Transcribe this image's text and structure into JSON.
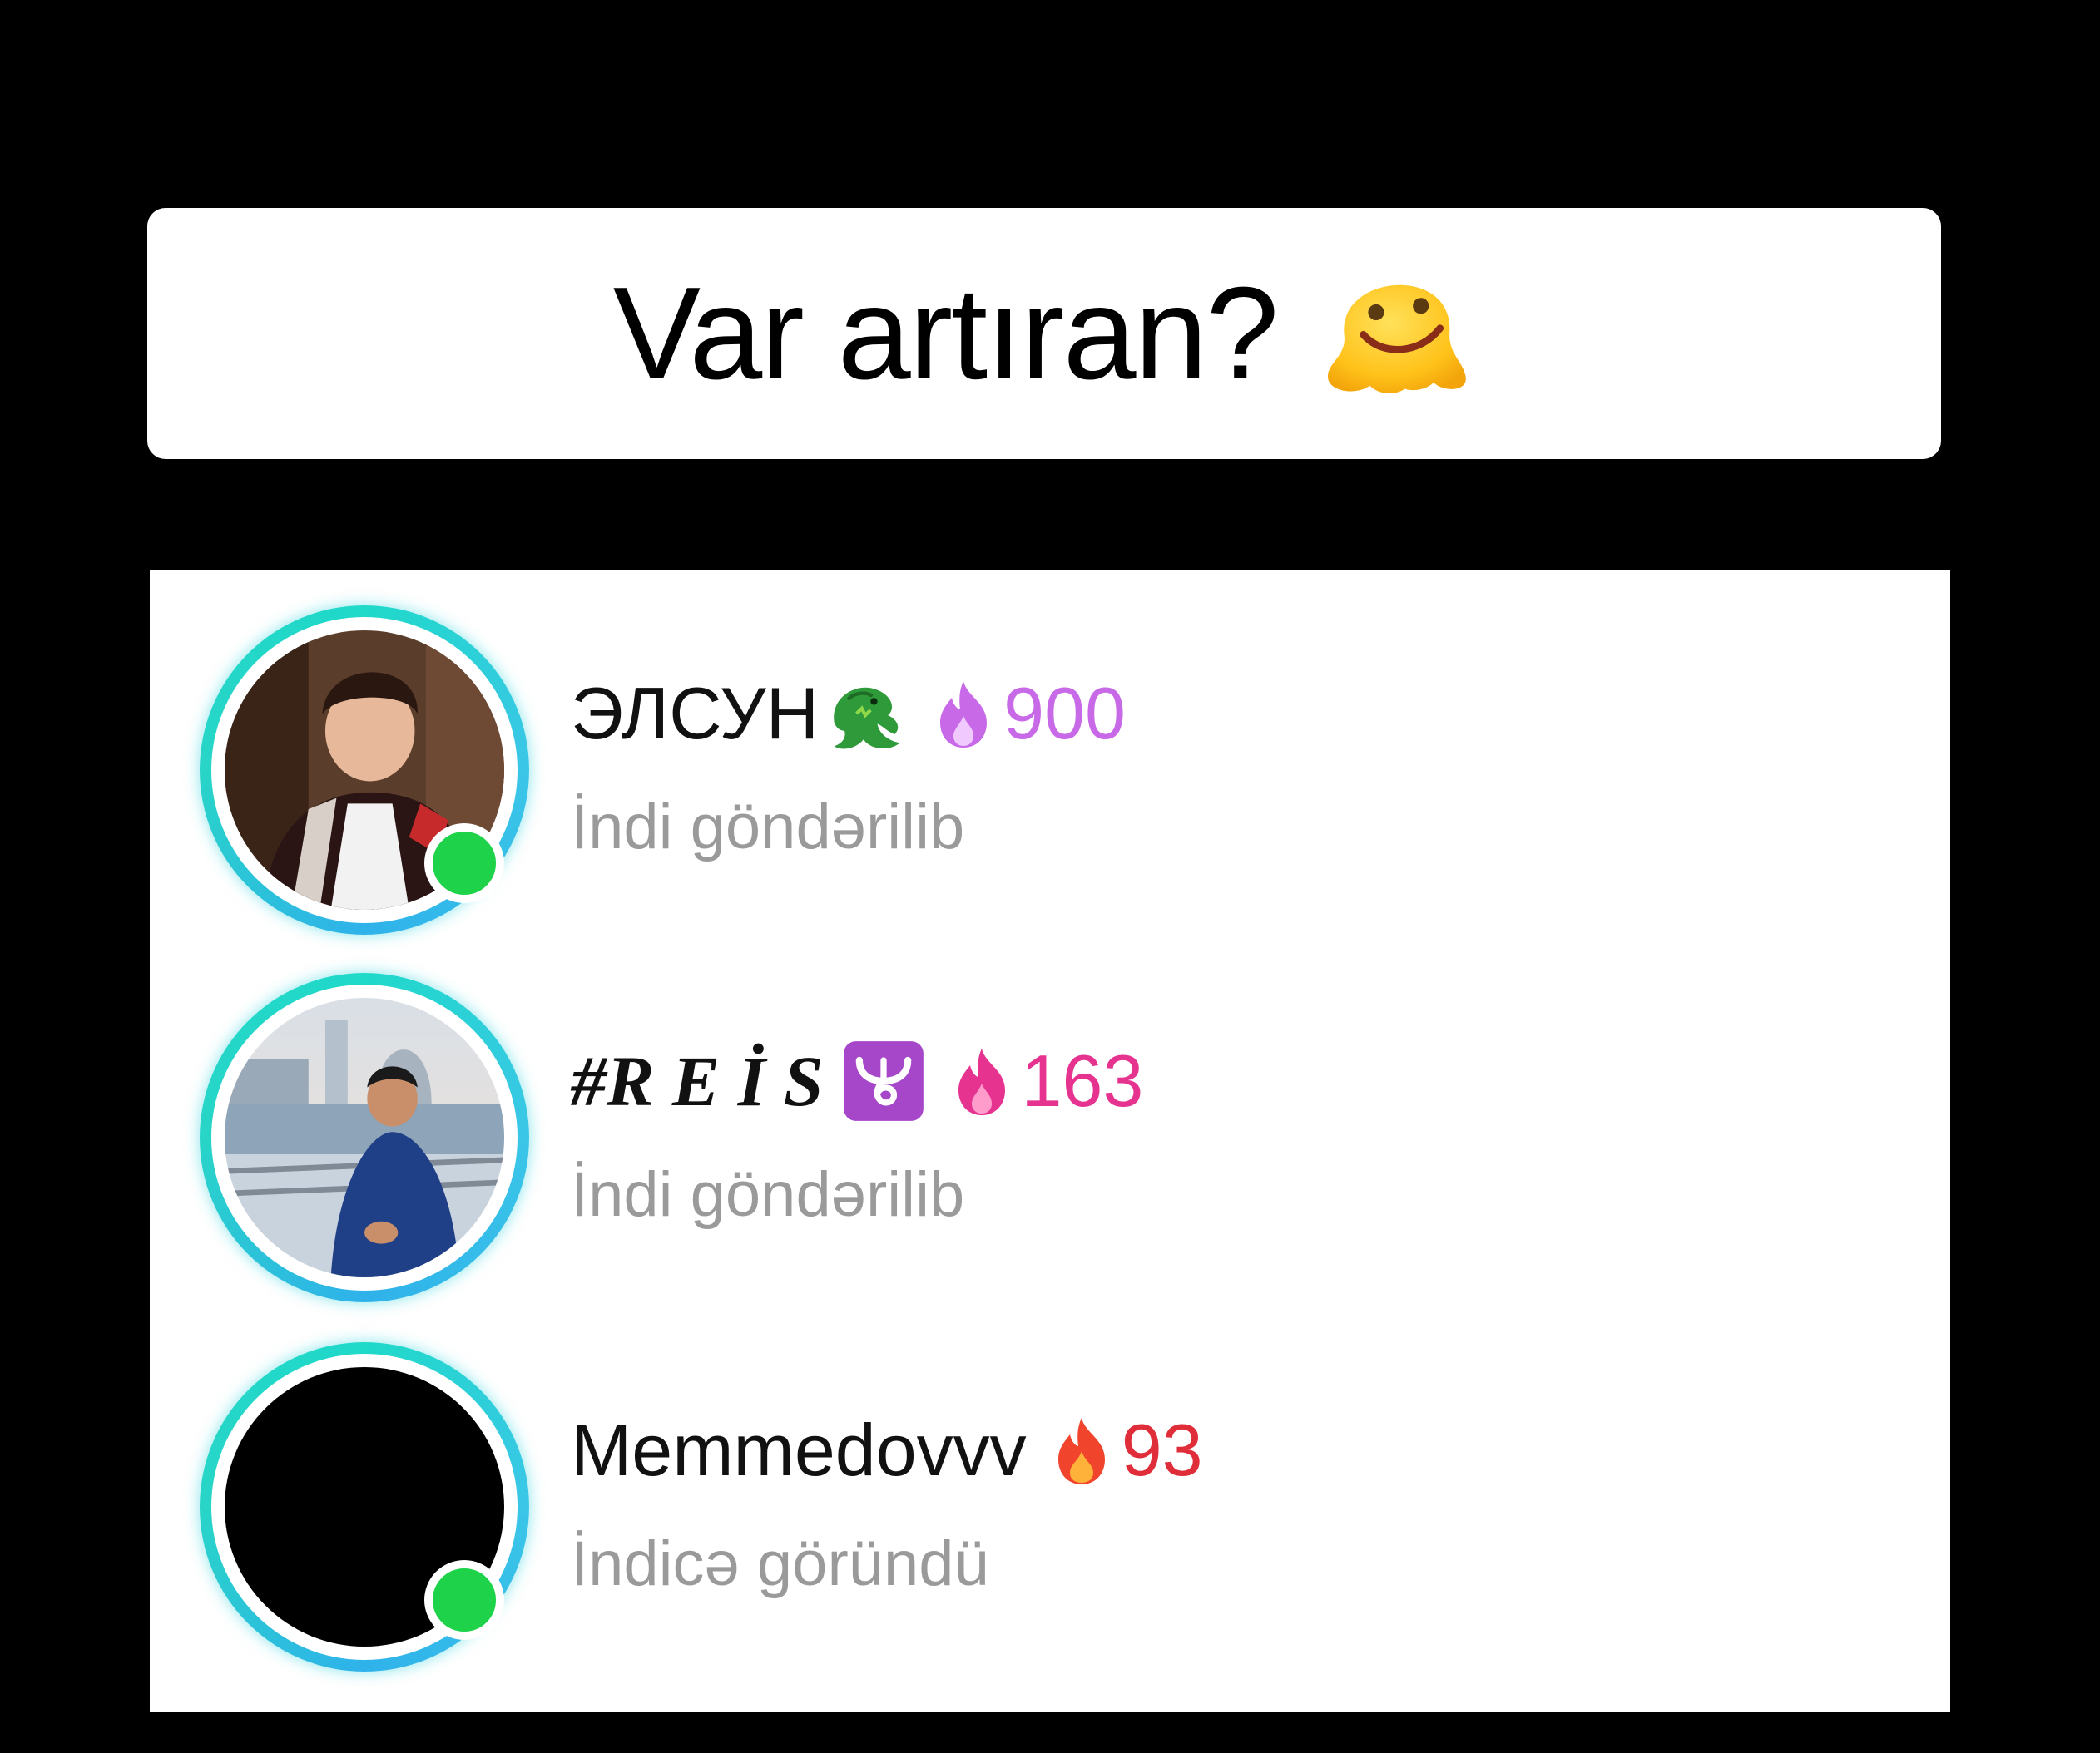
{
  "caption": {
    "text": "Var artıran?",
    "emoji": "melting-face-emoji"
  },
  "colors": {
    "ring_accent": "#1fd9c9",
    "online": "#1ed34a",
    "status_text": "#9a9a9a",
    "streak_purple": "#c86ae8",
    "streak_pink": "#e5338f",
    "streak_red": "#e02d3a"
  },
  "friends": [
    {
      "name": "ЭЛСУН",
      "name_emoji": "dragon-emoji",
      "streak_icon": "purple-flame-icon",
      "streak": "900",
      "status": "İndi göndərilib",
      "online": true
    },
    {
      "name": "#R E İ S",
      "name_emoji": "ophiuchus-emoji",
      "streak_icon": "pink-flame-icon",
      "streak": "163",
      "status": "İndi göndərilib",
      "online": false
    },
    {
      "name": "Memmedovvv",
      "name_emoji": "",
      "streak_icon": "red-flame-icon",
      "streak": "93",
      "status": "İndicə göründü",
      "online": true
    }
  ]
}
